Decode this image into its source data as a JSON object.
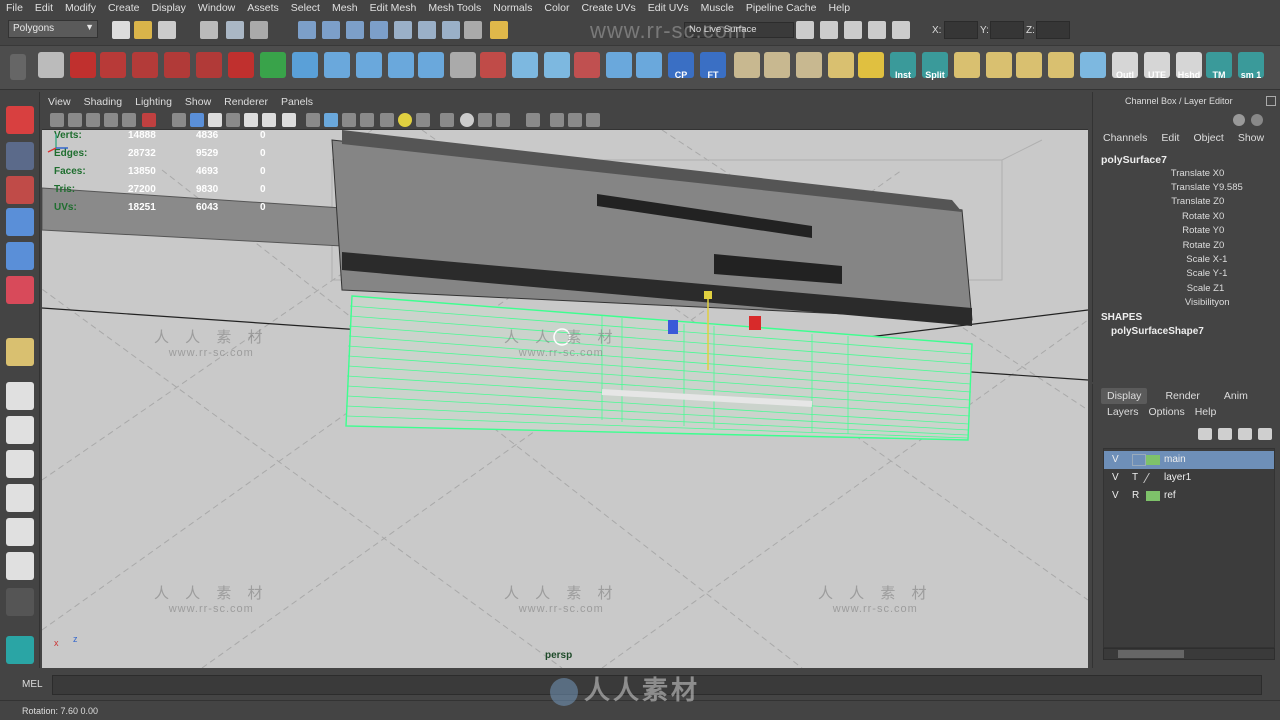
{
  "menubar": [
    "File",
    "Edit",
    "Modify",
    "Create",
    "Display",
    "Window",
    "Assets",
    "Select",
    "Mesh",
    "Edit Mesh",
    "Mesh Tools",
    "Normals",
    "Color",
    "Create UVs",
    "Edit UVs",
    "Muscle",
    "Pipeline Cache",
    "Help"
  ],
  "status_line": {
    "mode": "Polygons",
    "live_surface": "No Live Surface",
    "x_label": "X:",
    "y_label": "Y:",
    "z_label": "Z:",
    "watermark": "www.rr-sc.com"
  },
  "shelf": {
    "labels": [
      "CP",
      "FT",
      "Inst",
      "Split",
      "Outl",
      "UTE",
      "Hshd",
      "TM",
      "sm 1"
    ]
  },
  "panel_menu": [
    "View",
    "Shading",
    "Lighting",
    "Show",
    "Renderer",
    "Panels"
  ],
  "hud": [
    {
      "label": "Verts:",
      "v1": "14888",
      "v2": "4836",
      "v3": "0"
    },
    {
      "label": "Edges:",
      "v1": "28732",
      "v2": "9529",
      "v3": "0"
    },
    {
      "label": "Faces:",
      "v1": "13850",
      "v2": "4693",
      "v3": "0"
    },
    {
      "label": "Tris:",
      "v1": "27200",
      "v2": "9830",
      "v3": "0"
    },
    {
      "label": "UVs:",
      "v1": "18251",
      "v2": "6043",
      "v3": "0"
    }
  ],
  "viewport": {
    "camera": "persp",
    "watermarks": [
      {
        "cn": "人 人 素 材",
        "url": "www.rr-sc.com"
      },
      {
        "cn": "人 人 素 材",
        "url": "www.rr-sc.com"
      },
      {
        "cn": "人 人 素 材",
        "url": "www.rr-sc.com"
      },
      {
        "cn": "人 人 素 材",
        "url": "www.rr-sc.com"
      },
      {
        "cn": "人 人 素 材",
        "url": "www.rr-sc.com"
      }
    ],
    "axis_x": "x",
    "axis_z": "z",
    "wire_color": "#3dff8f"
  },
  "channel_box": {
    "title": "Channel Box / Layer Editor",
    "menu": [
      "Channels",
      "Edit",
      "Object",
      "Show"
    ],
    "object": "polySurface7",
    "attributes": [
      {
        "name": "Translate X",
        "value": "0"
      },
      {
        "name": "Translate Y",
        "value": "9.585"
      },
      {
        "name": "Translate Z",
        "value": "0"
      },
      {
        "name": "Rotate X",
        "value": "0"
      },
      {
        "name": "Rotate Y",
        "value": "0"
      },
      {
        "name": "Rotate Z",
        "value": "0"
      },
      {
        "name": "Scale X",
        "value": "-1"
      },
      {
        "name": "Scale Y",
        "value": "-1"
      },
      {
        "name": "Scale Z",
        "value": "1"
      },
      {
        "name": "Visibility",
        "value": "on"
      }
    ],
    "shapes_header": "SHAPES",
    "shape_name": "polySurfaceShape7"
  },
  "layer_editor": {
    "tabs": [
      "Display",
      "Render",
      "Anim"
    ],
    "active_tab": "Display",
    "menu": [
      "Layers",
      "Options",
      "Help"
    ],
    "layers": [
      {
        "v": "V",
        "t": "",
        "name": "main",
        "color": "#7ec26a",
        "selected": true
      },
      {
        "v": "V",
        "t": "T",
        "name": "layer1",
        "color": "",
        "selected": false
      },
      {
        "v": "V",
        "t": "R",
        "name": "ref",
        "color": "#7ec26a",
        "selected": false
      }
    ]
  },
  "command_line": {
    "label": "MEL"
  },
  "help_line": {
    "text": "Rotation:   7.60     0.00"
  },
  "logo_watermark": "人人素材"
}
